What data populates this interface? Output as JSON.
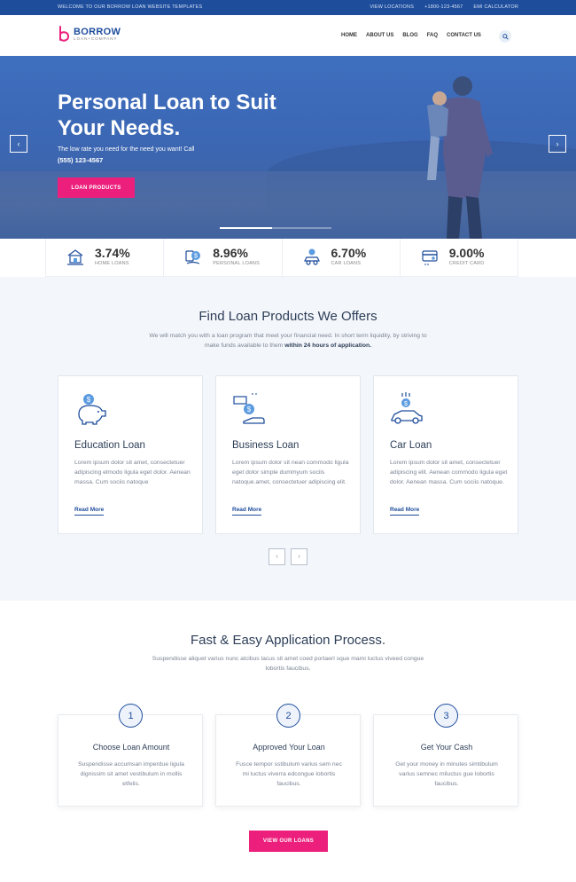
{
  "topbar": {
    "welcome": "WELCOME TO OUR BORROW LOAN WEBSITE TEMPLATES",
    "links": [
      "VIEW LOCATIONS",
      "+1800-123-4567",
      "EMI CALCULATOR"
    ]
  },
  "header": {
    "brand": "BORROW",
    "tagline": "LOAN+COMPANY",
    "nav": [
      "HOME",
      "ABOUT US",
      "BLOG",
      "FAQ",
      "CONTACT US"
    ],
    "search_icon": "search-icon"
  },
  "hero": {
    "title": "Personal Loan to Suit Your Needs.",
    "subtitle": "The low rate you need for the need you want! Call",
    "phone": "(555) 123-4567",
    "cta": "LOAN PRODUCTS",
    "slide_progress": 0.47
  },
  "rates": [
    {
      "value": "3.74%",
      "label": "HOME LOANS",
      "icon": "home-loan-icon"
    },
    {
      "value": "8.96%",
      "label": "PERSONAL LOANS",
      "icon": "personal-loan-icon"
    },
    {
      "value": "6.70%",
      "label": "CAR LOANS",
      "icon": "car-loan-icon"
    },
    {
      "value": "9.00%",
      "label": "CREDIT CARD",
      "icon": "credit-card-icon"
    }
  ],
  "products": {
    "title": "Find Loan Products We Offers",
    "desc_plain": "We will match you with a loan program that meet your financial need. In short term liquidity, by striving to make funds available to them",
    "desc_bold": "within 24 hours of application.",
    "cards": [
      {
        "title": "Education Loan",
        "text": "Lorem ipsum dolor sit amet, consectetuer adipiscing elmodo ligula eget dolor. Aenean massa. Cum sociis natoque",
        "link": "Read More",
        "icon": "piggy-bank-icon"
      },
      {
        "title": "Business Loan",
        "text": "Lorem ipsum dolor sit nean commodo ligula eget dolor simple dummyum sociis natoque.amet, consectetuer adipiscing elit.",
        "link": "Read More",
        "icon": "money-hand-icon"
      },
      {
        "title": "Car Loan",
        "text": "Lorem ipsum dolor sit amet, consectetuer adipiscing elit. Aenean commodo ligula eget dolor. Aenean massa. Cum sociis natoque.",
        "link": "Read More",
        "icon": "car-money-icon"
      }
    ],
    "prev": "‹",
    "next": "›"
  },
  "process": {
    "title": "Fast & Easy Application Process.",
    "desc": "Suspendisse aliquet varius nunc atcibus lacus sit amet coed portaerl sque mami luctus viveed congue lobortis faucibus.",
    "steps": [
      {
        "num": "1",
        "title": "Choose Loan Amount",
        "text": "Suspendisse accumsan imperdue ligula dignissim sit amet vestibulum in mollis etfelis."
      },
      {
        "num": "2",
        "title": "Approved Your Loan",
        "text": "Fusce tempor sstibulum varius sem nec mi luctus viverra edcongue lobortis faucibus."
      },
      {
        "num": "3",
        "title": "Get Your Cash",
        "text": "Get your money in minutes simtibulum varius semnec miluctus gue lobortis faucibus."
      }
    ],
    "cta": "VIEW OUR LOANS"
  },
  "colors": {
    "primary": "#1e4d9c",
    "accent": "#ec1f7d",
    "light_bg": "#f3f6fa"
  }
}
